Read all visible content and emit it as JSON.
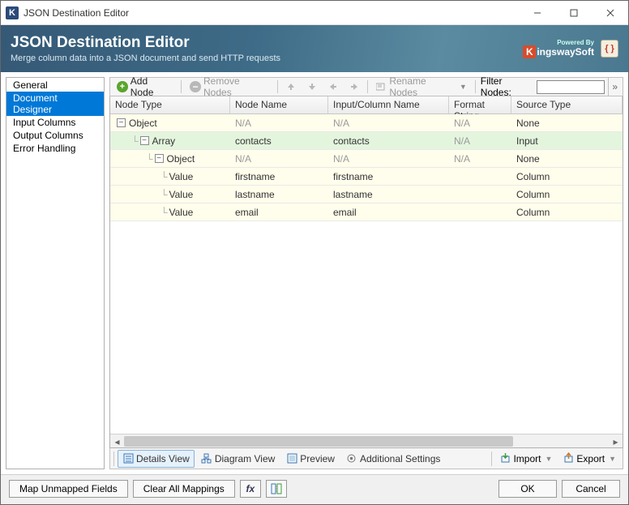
{
  "window": {
    "title": "JSON Destination Editor"
  },
  "banner": {
    "title": "JSON Destination Editor",
    "subtitle": "Merge column data into a JSON document and send HTTP requests",
    "powered_by": "Powered By",
    "brand": "ingswaySoft"
  },
  "sidebar": {
    "items": [
      {
        "label": "General",
        "selected": false
      },
      {
        "label": "Document Designer",
        "selected": true
      },
      {
        "label": "Input Columns",
        "selected": false
      },
      {
        "label": "Output Columns",
        "selected": false
      },
      {
        "label": "Error Handling",
        "selected": false
      }
    ]
  },
  "toolbar": {
    "add_node": "Add Node",
    "remove_nodes": "Remove Nodes",
    "rename_nodes": "Rename Nodes",
    "filter_label": "Filter Nodes:",
    "filter_value": ""
  },
  "grid": {
    "columns": [
      "Node Type",
      "Node Name",
      "Input/Column Name",
      "Format String",
      "Source Type"
    ],
    "rows": [
      {
        "indent": 0,
        "toggle": "-",
        "type": "Object",
        "name": "N/A",
        "input": "N/A",
        "fmt": "N/A",
        "src": "None",
        "na_name": true,
        "na_input": true,
        "na_fmt": true,
        "cls": "yellow"
      },
      {
        "indent": 1,
        "toggle": "-",
        "type": "Array",
        "name": "contacts",
        "input": "contacts",
        "fmt": "N/A",
        "src": "Input",
        "na_name": false,
        "na_input": false,
        "na_fmt": true,
        "cls": "green"
      },
      {
        "indent": 2,
        "toggle": "-",
        "type": "Object",
        "name": "N/A",
        "input": "N/A",
        "fmt": "N/A",
        "src": "None",
        "na_name": true,
        "na_input": true,
        "na_fmt": true,
        "cls": "yellow"
      },
      {
        "indent": 3,
        "toggle": "",
        "type": "Value",
        "name": "firstname",
        "input": "firstname",
        "fmt": "",
        "src": "Column",
        "na_name": false,
        "na_input": false,
        "na_fmt": false,
        "cls": "yellow"
      },
      {
        "indent": 3,
        "toggle": "",
        "type": "Value",
        "name": "lastname",
        "input": "lastname",
        "fmt": "",
        "src": "Column",
        "na_name": false,
        "na_input": false,
        "na_fmt": false,
        "cls": "yellow"
      },
      {
        "indent": 3,
        "toggle": "",
        "type": "Value",
        "name": "email",
        "input": "email",
        "fmt": "",
        "src": "Column",
        "na_name": false,
        "na_input": false,
        "na_fmt": false,
        "cls": "yellow"
      }
    ]
  },
  "viewtabs": {
    "details": "Details View",
    "diagram": "Diagram View",
    "preview": "Preview",
    "additional": "Additional Settings",
    "import": "Import",
    "export": "Export"
  },
  "footer": {
    "map_unmapped": "Map Unmapped Fields",
    "clear_all": "Clear All Mappings",
    "ok": "OK",
    "cancel": "Cancel"
  }
}
